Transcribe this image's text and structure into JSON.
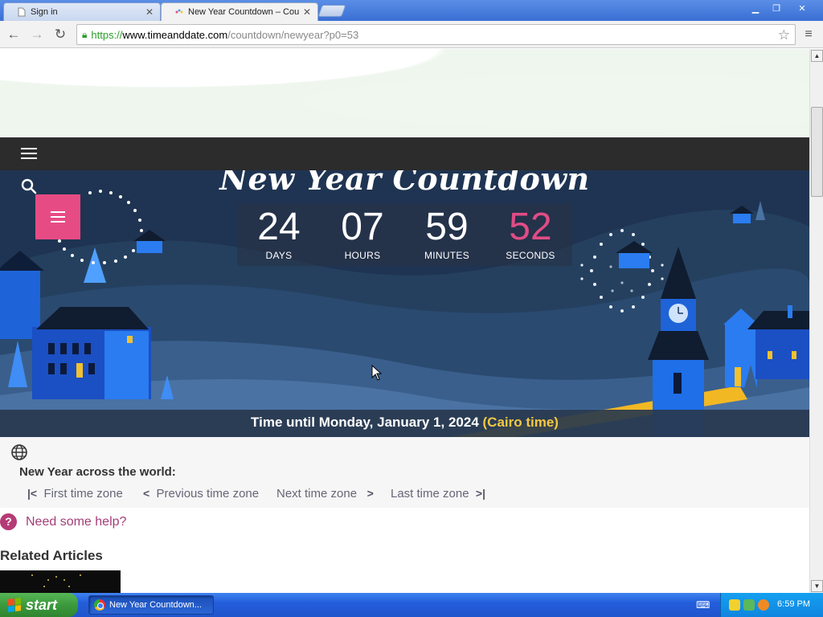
{
  "browser": {
    "tabs": [
      {
        "title": "Sign in",
        "active": false
      },
      {
        "title": "New Year Countdown – Cou",
        "active": true
      }
    ],
    "url": {
      "scheme": "https://",
      "host": "www.timeanddate.com",
      "path": "/countdown/newyear?p0=53"
    }
  },
  "page": {
    "hero_title": "New Year Countdown",
    "countdown": [
      {
        "value": "24",
        "label": "DAYS"
      },
      {
        "value": "07",
        "label": "HOURS"
      },
      {
        "value": "59",
        "label": "MINUTES"
      },
      {
        "value": "52",
        "label": "SECONDS"
      }
    ],
    "until": {
      "prefix": "Time until Monday, January 1, 2024 ",
      "zone": "(Cairo time)"
    },
    "across_title": "New Year across the world:",
    "tz_nav": {
      "first": "First time zone",
      "previous": "Previous time zone",
      "next": "Next time zone",
      "last": "Last time zone"
    },
    "help_link": "Need some help?",
    "related_heading": "Related Articles"
  },
  "taskbar": {
    "start_label": "start",
    "window_item": "New Year Countdown...",
    "clock": "6:59 PM"
  },
  "colors": {
    "seconds_accent": "#e04c85",
    "zone_accent": "#f4c842",
    "help_link": "#a33d78"
  }
}
